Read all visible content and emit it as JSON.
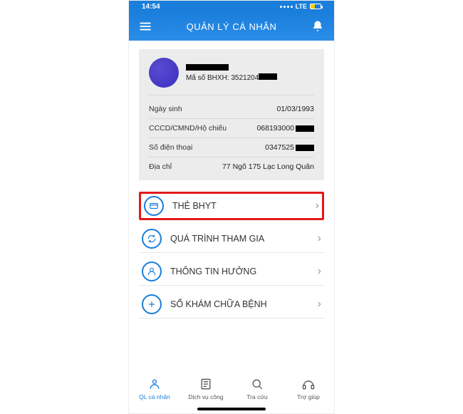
{
  "status": {
    "time": "14:54",
    "network": "LTE"
  },
  "header": {
    "title": "QUẢN LÝ CÁ NHÂN"
  },
  "profile": {
    "bhxh_label": "Mã số BHXH:",
    "bhxh_value": "3521204",
    "fields": [
      {
        "label": "Ngày sinh",
        "value": "01/03/1993",
        "redact": false
      },
      {
        "label": "CCCD/CMND/Hộ chiếu",
        "value": "068193000",
        "redact": true
      },
      {
        "label": "Số điện thoại",
        "value": "0347525",
        "redact": true
      },
      {
        "label": "Địa chỉ",
        "value": "77 Ngõ 175 Lạc Long Quân",
        "redact": false
      }
    ]
  },
  "menu": [
    {
      "name": "the-bhyt",
      "label": "THẺ BHYT",
      "highlight": true,
      "icon": "card-icon"
    },
    {
      "name": "qua-trinh",
      "label": "QUÁ TRÌNH THAM GIA",
      "highlight": false,
      "icon": "refresh-icon"
    },
    {
      "name": "thong-tin-huong",
      "label": "THÔNG TIN HƯỞNG",
      "highlight": false,
      "icon": "user-icon"
    },
    {
      "name": "so-kham",
      "label": "SỔ KHÁM CHỮA BỆNH",
      "highlight": false,
      "icon": "plus-icon"
    }
  ],
  "tabs": [
    {
      "name": "ql-ca-nhan",
      "label": "QL cá nhân",
      "active": true
    },
    {
      "name": "dich-vu-cong",
      "label": "Dịch vụ công",
      "active": false
    },
    {
      "name": "tra-cuu",
      "label": "Tra cứu",
      "active": false
    },
    {
      "name": "tro-giup",
      "label": "Trợ giúp",
      "active": false
    }
  ]
}
